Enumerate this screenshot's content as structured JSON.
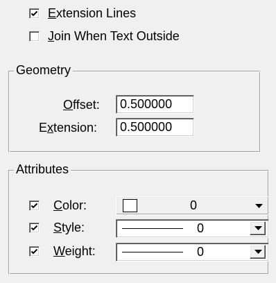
{
  "top_options": {
    "extension_lines": {
      "checked": true,
      "label_pre": "",
      "label_key": "E",
      "label_post": "xtension Lines"
    },
    "join_when_text_outside": {
      "checked": false,
      "label_pre": "",
      "label_key": "J",
      "label_post": "oin When Text Outside"
    }
  },
  "geometry": {
    "title": "Geometry",
    "offset": {
      "label_pre": "",
      "label_key": "O",
      "label_post": "ffset:",
      "value": "0.500000"
    },
    "extension": {
      "label_pre": "E",
      "label_key": "x",
      "label_post": "tension:",
      "value": "0.500000"
    }
  },
  "attributes": {
    "title": "Attributes",
    "color": {
      "checked": true,
      "label_pre": "",
      "label_key": "C",
      "label_post": "olor:",
      "value": "0",
      "swatch_color": "#ffffff"
    },
    "style": {
      "checked": true,
      "label_pre": "",
      "label_key": "S",
      "label_post": "tyle:",
      "value": "0"
    },
    "weight": {
      "checked": true,
      "label_pre": "",
      "label_key": "W",
      "label_post": "eight:",
      "value": "0"
    }
  },
  "icons": {
    "check": "checkmark-icon",
    "dropdown": "triangle-down-icon"
  },
  "colors": {
    "window_bg": "#f0f0f0",
    "field_bg": "#ffffff",
    "text": "#000000"
  }
}
